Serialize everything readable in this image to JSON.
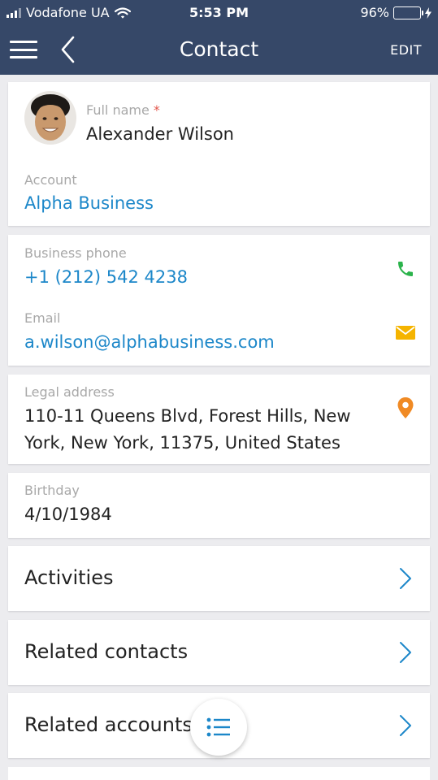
{
  "status_bar": {
    "carrier": "Vodafone UA",
    "time": "5:53 PM",
    "battery_percent": "96%",
    "battery_level": 0.96
  },
  "header": {
    "title": "Contact",
    "edit_label": "EDIT"
  },
  "profile": {
    "full_name_label": "Full name",
    "required_mark": "*",
    "full_name": "Alexander Wilson",
    "account_label": "Account",
    "account": "Alpha Business"
  },
  "communication": {
    "phone_label": "Business phone",
    "phone": "+1 (212) 542 4238",
    "email_label": "Email",
    "email": "a.wilson@alphabusiness.com"
  },
  "address": {
    "label": "Legal address",
    "line1": "110-11 Queens Blvd, Forest Hills, New",
    "line2": "York, New York, 11375, United States"
  },
  "birthday": {
    "label": "Birthday",
    "value": "4/10/1984"
  },
  "sections": [
    {
      "label": "Activities"
    },
    {
      "label": "Related contacts"
    },
    {
      "label": "Related accounts"
    }
  ],
  "colors": {
    "header_bg": "#364868",
    "link": "#1c87c9",
    "phone_icon": "#2bb34b",
    "email_icon": "#f5b400",
    "location_icon": "#f08a24",
    "required": "#e2574c",
    "battery": "#4cd964"
  },
  "icons": {
    "menu": "menu-icon",
    "back": "back-icon",
    "phone": "phone-icon",
    "email": "envelope-icon",
    "location": "map-pin-icon",
    "chevron": "chevron-right-icon",
    "fab": "list-icon"
  }
}
